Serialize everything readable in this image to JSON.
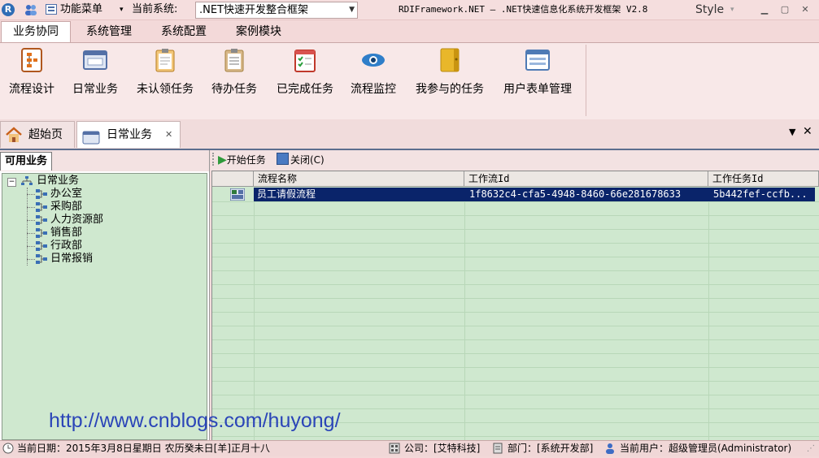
{
  "titlebar": {
    "menu_label": "功能菜单",
    "current_system_label": "当前系统:",
    "current_system_value": ".NET快速开发整合框架",
    "app_title": "RDIFramework.NET — .NET快速信息化系统开发框架 V2.8",
    "style_label": "Style"
  },
  "ribbon": {
    "tabs": [
      "业务协同",
      "系统管理",
      "系统配置",
      "案例模块"
    ],
    "buttons": [
      "流程设计",
      "日常业务",
      "未认领任务",
      "待办任务",
      "已完成任务",
      "流程监控",
      "我参与的任务",
      "用户表单管理"
    ]
  },
  "doctabs": {
    "home": "超始页",
    "active": "日常业务"
  },
  "leftpane": {
    "tab": "可用业务",
    "tree_root": "日常业务",
    "tree_children": [
      "办公室",
      "采购部",
      "人力资源部",
      "销售部",
      "行政部",
      "日常报销"
    ]
  },
  "toolbar": {
    "start": "开始任务",
    "close": "关闭(C)"
  },
  "grid": {
    "columns": [
      "流程名称",
      "工作流Id",
      "工作任务Id"
    ],
    "rows": [
      {
        "name": "员工请假流程",
        "workflow_id": "1f8632c4-cfa5-4948-8460-66e281678633",
        "task_id": "5b442fef-ccfb..."
      }
    ]
  },
  "watermark": "http://www.cnblogs.com/huyong/",
  "statusbar": {
    "date": "当前日期：2015年3月8日星期日 农历癸未日[羊]正月十八",
    "company": "公司：[艾特科技]",
    "department": "部门：[系统开发部]",
    "user": "当前用户：超级管理员(Administrator)"
  }
}
